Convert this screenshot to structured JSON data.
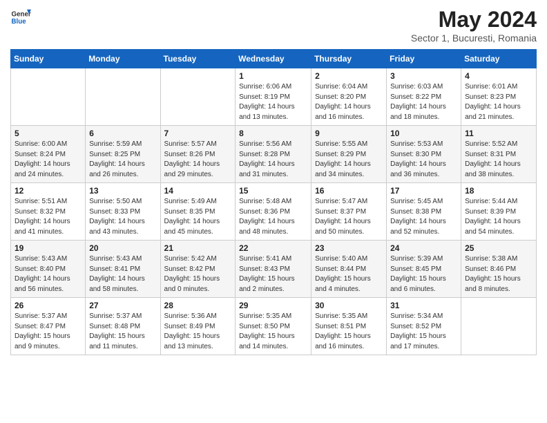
{
  "header": {
    "logo_general": "General",
    "logo_blue": "Blue",
    "month_title": "May 2024",
    "subtitle": "Sector 1, Bucuresti, Romania"
  },
  "weekdays": [
    "Sunday",
    "Monday",
    "Tuesday",
    "Wednesday",
    "Thursday",
    "Friday",
    "Saturday"
  ],
  "weeks": [
    [
      {
        "day": "",
        "info": ""
      },
      {
        "day": "",
        "info": ""
      },
      {
        "day": "",
        "info": ""
      },
      {
        "day": "1",
        "info": "Sunrise: 6:06 AM\nSunset: 8:19 PM\nDaylight: 14 hours\nand 13 minutes."
      },
      {
        "day": "2",
        "info": "Sunrise: 6:04 AM\nSunset: 8:20 PM\nDaylight: 14 hours\nand 16 minutes."
      },
      {
        "day": "3",
        "info": "Sunrise: 6:03 AM\nSunset: 8:22 PM\nDaylight: 14 hours\nand 18 minutes."
      },
      {
        "day": "4",
        "info": "Sunrise: 6:01 AM\nSunset: 8:23 PM\nDaylight: 14 hours\nand 21 minutes."
      }
    ],
    [
      {
        "day": "5",
        "info": "Sunrise: 6:00 AM\nSunset: 8:24 PM\nDaylight: 14 hours\nand 24 minutes."
      },
      {
        "day": "6",
        "info": "Sunrise: 5:59 AM\nSunset: 8:25 PM\nDaylight: 14 hours\nand 26 minutes."
      },
      {
        "day": "7",
        "info": "Sunrise: 5:57 AM\nSunset: 8:26 PM\nDaylight: 14 hours\nand 29 minutes."
      },
      {
        "day": "8",
        "info": "Sunrise: 5:56 AM\nSunset: 8:28 PM\nDaylight: 14 hours\nand 31 minutes."
      },
      {
        "day": "9",
        "info": "Sunrise: 5:55 AM\nSunset: 8:29 PM\nDaylight: 14 hours\nand 34 minutes."
      },
      {
        "day": "10",
        "info": "Sunrise: 5:53 AM\nSunset: 8:30 PM\nDaylight: 14 hours\nand 36 minutes."
      },
      {
        "day": "11",
        "info": "Sunrise: 5:52 AM\nSunset: 8:31 PM\nDaylight: 14 hours\nand 38 minutes."
      }
    ],
    [
      {
        "day": "12",
        "info": "Sunrise: 5:51 AM\nSunset: 8:32 PM\nDaylight: 14 hours\nand 41 minutes."
      },
      {
        "day": "13",
        "info": "Sunrise: 5:50 AM\nSunset: 8:33 PM\nDaylight: 14 hours\nand 43 minutes."
      },
      {
        "day": "14",
        "info": "Sunrise: 5:49 AM\nSunset: 8:35 PM\nDaylight: 14 hours\nand 45 minutes."
      },
      {
        "day": "15",
        "info": "Sunrise: 5:48 AM\nSunset: 8:36 PM\nDaylight: 14 hours\nand 48 minutes."
      },
      {
        "day": "16",
        "info": "Sunrise: 5:47 AM\nSunset: 8:37 PM\nDaylight: 14 hours\nand 50 minutes."
      },
      {
        "day": "17",
        "info": "Sunrise: 5:45 AM\nSunset: 8:38 PM\nDaylight: 14 hours\nand 52 minutes."
      },
      {
        "day": "18",
        "info": "Sunrise: 5:44 AM\nSunset: 8:39 PM\nDaylight: 14 hours\nand 54 minutes."
      }
    ],
    [
      {
        "day": "19",
        "info": "Sunrise: 5:43 AM\nSunset: 8:40 PM\nDaylight: 14 hours\nand 56 minutes."
      },
      {
        "day": "20",
        "info": "Sunrise: 5:43 AM\nSunset: 8:41 PM\nDaylight: 14 hours\nand 58 minutes."
      },
      {
        "day": "21",
        "info": "Sunrise: 5:42 AM\nSunset: 8:42 PM\nDaylight: 15 hours\nand 0 minutes."
      },
      {
        "day": "22",
        "info": "Sunrise: 5:41 AM\nSunset: 8:43 PM\nDaylight: 15 hours\nand 2 minutes."
      },
      {
        "day": "23",
        "info": "Sunrise: 5:40 AM\nSunset: 8:44 PM\nDaylight: 15 hours\nand 4 minutes."
      },
      {
        "day": "24",
        "info": "Sunrise: 5:39 AM\nSunset: 8:45 PM\nDaylight: 15 hours\nand 6 minutes."
      },
      {
        "day": "25",
        "info": "Sunrise: 5:38 AM\nSunset: 8:46 PM\nDaylight: 15 hours\nand 8 minutes."
      }
    ],
    [
      {
        "day": "26",
        "info": "Sunrise: 5:37 AM\nSunset: 8:47 PM\nDaylight: 15 hours\nand 9 minutes."
      },
      {
        "day": "27",
        "info": "Sunrise: 5:37 AM\nSunset: 8:48 PM\nDaylight: 15 hours\nand 11 minutes."
      },
      {
        "day": "28",
        "info": "Sunrise: 5:36 AM\nSunset: 8:49 PM\nDaylight: 15 hours\nand 13 minutes."
      },
      {
        "day": "29",
        "info": "Sunrise: 5:35 AM\nSunset: 8:50 PM\nDaylight: 15 hours\nand 14 minutes."
      },
      {
        "day": "30",
        "info": "Sunrise: 5:35 AM\nSunset: 8:51 PM\nDaylight: 15 hours\nand 16 minutes."
      },
      {
        "day": "31",
        "info": "Sunrise: 5:34 AM\nSunset: 8:52 PM\nDaylight: 15 hours\nand 17 minutes."
      },
      {
        "day": "",
        "info": ""
      }
    ]
  ]
}
